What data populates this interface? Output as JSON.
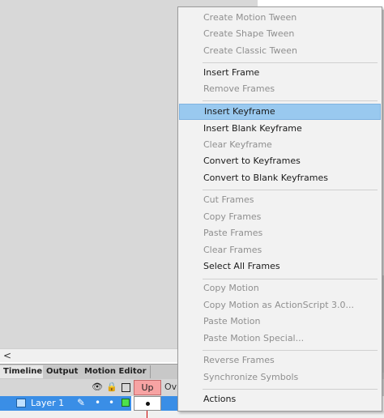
{
  "timeline": {
    "tabs": [
      "Timeline",
      "Output",
      "Motion Editor"
    ],
    "frame_label": "Up",
    "frame_label_next": "Ov",
    "layer_name": "Layer 1",
    "scroll_arrow": "<"
  },
  "menu": {
    "items": [
      {
        "label": "Create Motion Tween",
        "enabled": false
      },
      {
        "label": "Create Shape Tween",
        "enabled": false
      },
      {
        "label": "Create Classic Tween",
        "enabled": false
      },
      {
        "label": "Insert Frame",
        "enabled": true
      },
      {
        "label": "Remove Frames",
        "enabled": false
      },
      {
        "label": "Insert Keyframe",
        "enabled": true,
        "highlighted": true
      },
      {
        "label": "Insert Blank Keyframe",
        "enabled": true
      },
      {
        "label": "Clear Keyframe",
        "enabled": false
      },
      {
        "label": "Convert to Keyframes",
        "enabled": true
      },
      {
        "label": "Convert to Blank Keyframes",
        "enabled": true
      },
      {
        "label": "Cut Frames",
        "enabled": false
      },
      {
        "label": "Copy Frames",
        "enabled": false
      },
      {
        "label": "Paste Frames",
        "enabled": false
      },
      {
        "label": "Clear Frames",
        "enabled": false
      },
      {
        "label": "Select All Frames",
        "enabled": true
      },
      {
        "label": "Copy Motion",
        "enabled": false
      },
      {
        "label": "Copy Motion as ActionScript 3.0...",
        "enabled": false
      },
      {
        "label": "Paste Motion",
        "enabled": false
      },
      {
        "label": "Paste Motion Special...",
        "enabled": false
      },
      {
        "label": "Reverse Frames",
        "enabled": false
      },
      {
        "label": "Synchronize Symbols",
        "enabled": false
      },
      {
        "label": "Actions",
        "enabled": true
      }
    ]
  },
  "colors": {
    "highlight": "#99c9ef",
    "layer_selected": "#3a8ee6",
    "frame_label_bg": "#f7a3a3",
    "layer_color_box": "#4de14d"
  }
}
